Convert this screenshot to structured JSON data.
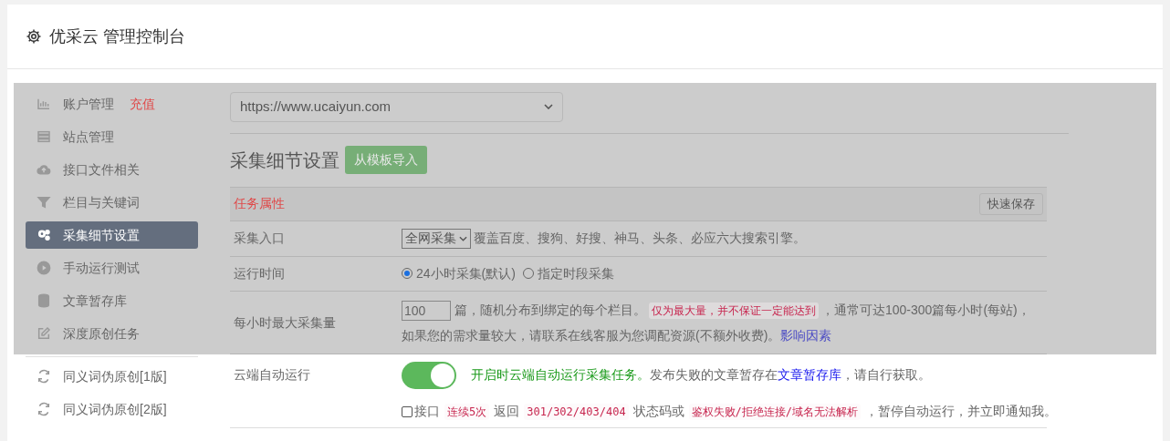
{
  "header": {
    "title": "优采云 管理控制台"
  },
  "sidebar": {
    "items": [
      {
        "label": "账户管理",
        "badge": "充值",
        "selected": false
      },
      {
        "label": "站点管理",
        "selected": false
      },
      {
        "label": "接口文件相关",
        "selected": false
      },
      {
        "label": "栏目与关键词",
        "selected": false
      },
      {
        "label": "采集细节设置",
        "selected": true
      },
      {
        "label": "手动运行测试",
        "selected": false
      },
      {
        "label": "文章暂存库",
        "selected": false
      },
      {
        "label": "深度原创任务",
        "selected": false
      }
    ],
    "extra_items": [
      {
        "label": "同义词伪原创[1版]"
      },
      {
        "label": "同义词伪原创[2版]"
      }
    ]
  },
  "site_select": {
    "value": "https://www.ucaiyun.com"
  },
  "section": {
    "title": "采集细节设置",
    "import_button": "从模板导入"
  },
  "panel": {
    "title": "任务属性",
    "save_button": "快速保存"
  },
  "rows": [
    {
      "kind": "select",
      "label": "采集入口",
      "value": "全网采集",
      "note": "覆盖百度、搜狗、好搜、神马、头条、必应六大搜索引擎。"
    },
    {
      "kind": "radio",
      "label": "运行时间",
      "options": [
        {
          "label": "24小时采集(默认)",
          "selected": true
        },
        {
          "label": "指定时段采集",
          "selected": false
        }
      ]
    },
    {
      "kind": "amount",
      "label": "每小时最大采集量",
      "value": "100",
      "text1": "篇，随机分布到绑定的每个栏目。",
      "code": "仅为最大量，并不保证一定能达到",
      "text2": "，通常可达100-300篇每小时(每站)，",
      "text3": "如果您的需求量较大，请联系在线客服为您调配资源(不额外收费)。",
      "link": "影响因素"
    }
  ],
  "lower_rows": [
    {
      "kind": "toggle",
      "label": "云端自动运行",
      "on": true,
      "green_text": "开启时云端自动运行采集任务。",
      "text1": "发布失败的文章暂存在",
      "link": "文章暂存库",
      "text2": "，请自行获取。"
    },
    {
      "kind": "check",
      "checked": false,
      "parts": [
        {
          "kind": "text",
          "text": "接口"
        },
        {
          "kind": "code",
          "text": "连续5次"
        },
        {
          "kind": "text",
          "text": "返回"
        },
        {
          "kind": "code",
          "text": "301/302/403/404"
        },
        {
          "kind": "text",
          "text": "状态码或"
        },
        {
          "kind": "code",
          "text": "鉴权失败/拒绝连接/域名无法解析"
        },
        {
          "kind": "text",
          "text": "，暂停自动运行，并立即通知我。"
        }
      ]
    }
  ]
}
